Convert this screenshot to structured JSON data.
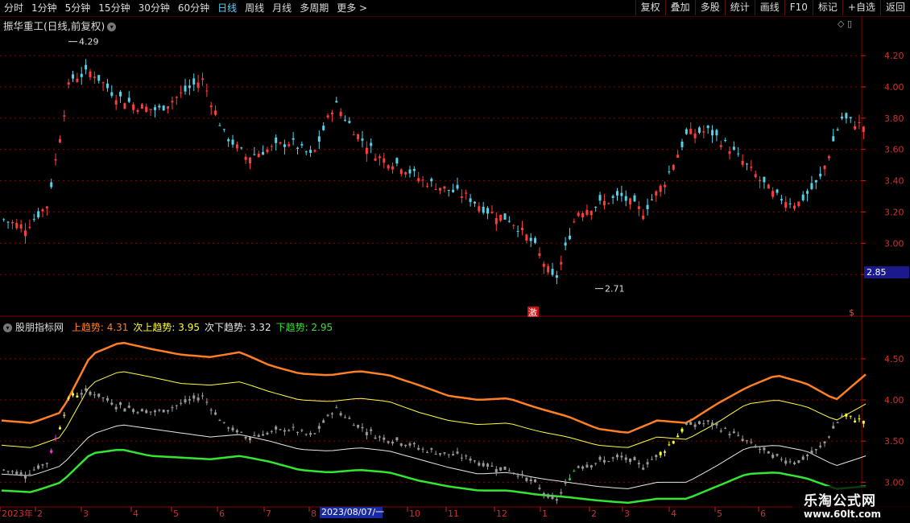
{
  "toolbar": {
    "periods": [
      {
        "label": "分时",
        "active": false
      },
      {
        "label": "1分钟",
        "active": false
      },
      {
        "label": "5分钟",
        "active": false
      },
      {
        "label": "15分钟",
        "active": false
      },
      {
        "label": "30分钟",
        "active": false
      },
      {
        "label": "60分钟",
        "active": false
      },
      {
        "label": "日线",
        "active": true
      },
      {
        "label": "周线",
        "active": false
      },
      {
        "label": "月线",
        "active": false
      },
      {
        "label": "多周期",
        "active": false
      },
      {
        "label": "更多 >",
        "active": false
      }
    ],
    "tools": [
      "复权",
      "叠加",
      "多股",
      "统计",
      "画线",
      "F10",
      "标记",
      "+自选",
      "返回"
    ]
  },
  "main_chart": {
    "title": "振华重工(日线,前复权)",
    "high_label": "4.29",
    "low_label": "2.71",
    "current_price": "2.85",
    "y_ticks": [
      "4.20",
      "4.00",
      "3.80",
      "3.60",
      "3.40",
      "3.20",
      "3.00",
      "2.80"
    ],
    "marker_left": "激",
    "marker_right": "$"
  },
  "indicator": {
    "name": "股朋指标网",
    "legend": [
      {
        "label": "上趋势: 4.31",
        "color": "#ff7f24"
      },
      {
        "label": "次上趋势: 3.95",
        "color": "#ffff40"
      },
      {
        "label": "次下趋势: 3.32",
        "color": "#e8e8e8"
      },
      {
        "label": "下趋势: 2.95",
        "color": "#32e632"
      }
    ],
    "y_ticks": [
      "4.50",
      "4.00",
      "3.50",
      "3.00"
    ]
  },
  "x_axis": {
    "labels": [
      "2023年",
      "2",
      "3",
      "4",
      "5",
      "6",
      "7",
      "8",
      "9",
      "10",
      "11",
      "12",
      "1",
      "2",
      "3",
      "4",
      "5",
      "6"
    ],
    "cursor_date": "2023/08/07/一"
  },
  "watermark": {
    "name": "乐淘公式网",
    "url": "www.60lt.com"
  },
  "chart_data": {
    "type": "line",
    "xlabel": "",
    "ylabel": "",
    "main_ylim": [
      2.6,
      4.35
    ],
    "indicator_ylim": [
      2.75,
      4.85
    ],
    "series": [
      {
        "name": "上趋势",
        "color": "#ff7f24",
        "values": [
          3.75,
          3.72,
          3.85,
          4.55,
          4.7,
          4.62,
          4.55,
          4.52,
          4.58,
          4.42,
          4.32,
          4.3,
          4.35,
          4.3,
          4.18,
          4.05,
          4.0,
          4.02,
          3.9,
          3.8,
          3.65,
          3.6,
          3.75,
          3.72,
          3.95,
          4.15,
          4.3,
          4.2,
          4.0,
          4.31
        ]
      },
      {
        "name": "次上趋势",
        "color": "#ffff40",
        "values": [
          3.45,
          3.42,
          3.55,
          4.2,
          4.35,
          4.28,
          4.2,
          4.18,
          4.22,
          4.1,
          4.0,
          3.98,
          4.02,
          3.98,
          3.85,
          3.75,
          3.7,
          3.72,
          3.62,
          3.55,
          3.45,
          3.42,
          3.55,
          3.52,
          3.72,
          3.95,
          4.0,
          3.92,
          3.75,
          3.95
        ]
      },
      {
        "name": "次下趋势",
        "color": "#e8e8e8",
        "values": [
          3.1,
          3.08,
          3.2,
          3.58,
          3.7,
          3.65,
          3.6,
          3.55,
          3.58,
          3.5,
          3.4,
          3.38,
          3.42,
          3.38,
          3.28,
          3.18,
          3.1,
          3.12,
          3.05,
          3.0,
          2.95,
          2.92,
          3.0,
          3.0,
          3.2,
          3.42,
          3.45,
          3.38,
          3.2,
          3.32
        ]
      },
      {
        "name": "下趋势",
        "color": "#32e632",
        "values": [
          2.9,
          2.88,
          3.0,
          3.35,
          3.4,
          3.32,
          3.3,
          3.28,
          3.32,
          3.25,
          3.15,
          3.12,
          3.15,
          3.12,
          3.02,
          2.95,
          2.9,
          2.9,
          2.85,
          2.82,
          2.78,
          2.75,
          2.8,
          2.8,
          2.95,
          3.1,
          3.12,
          3.05,
          2.92,
          2.95
        ]
      }
    ],
    "price_close": [
      3.15,
      3.1,
      3.25,
      4.05,
      4.1,
      3.95,
      3.88,
      3.85,
      3.95,
      4.05,
      3.7,
      3.55,
      3.6,
      3.65,
      3.55,
      3.9,
      3.7,
      3.55,
      3.5,
      3.4,
      3.35,
      3.3,
      3.2,
      3.15,
      3.0,
      2.75,
      3.2,
      3.25,
      3.3,
      3.2,
      3.4,
      3.7,
      3.72,
      3.6,
      3.45,
      3.3,
      3.25,
      3.4,
      3.8,
      3.75
    ]
  }
}
